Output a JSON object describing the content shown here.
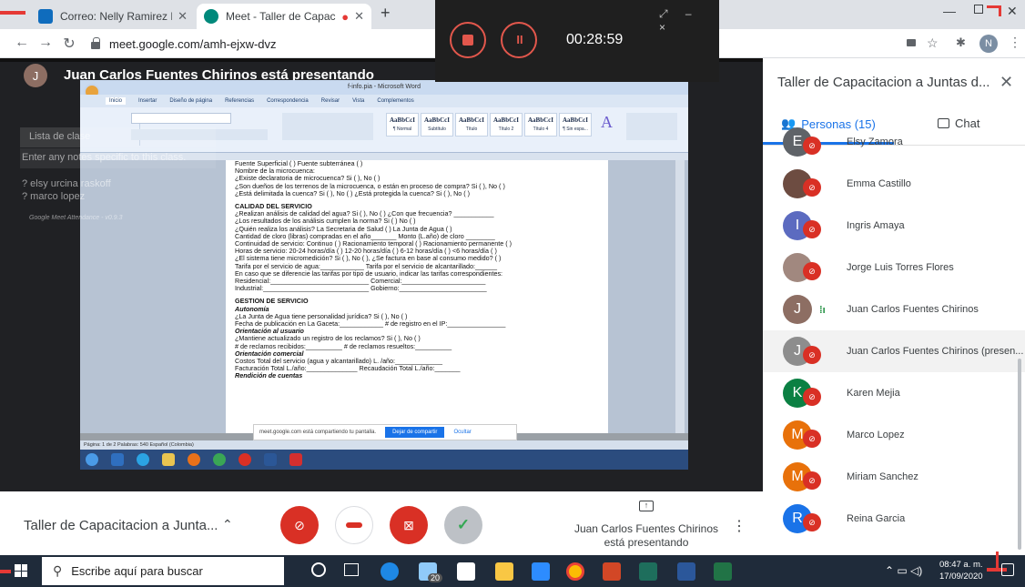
{
  "browser": {
    "tabs": [
      {
        "title": "Correo: Nelly Ramirez Lagos - Ou",
        "icon_color": "#0f6cbd"
      },
      {
        "title": "Meet - Taller de Capacitacion",
        "icon_color": "#00897b"
      }
    ],
    "new_tab": "+",
    "url": "meet.google.com/amh-ejxw-dvz",
    "profile_initial": "N"
  },
  "recorder": {
    "time": "00:28:59",
    "controls": "⤢ – ×"
  },
  "presenter": {
    "initial": "J",
    "title": "Juan Carlos Fuentes Chirinos está presentando"
  },
  "shared_screen": {
    "window_title": "f-info.pia - Microsoft Word",
    "ribbon_tabs": [
      "Inicio",
      "Insertar",
      "Diseño de página",
      "Referencias",
      "Correspondencia",
      "Revisar",
      "Vista",
      "Complementos"
    ],
    "styles": [
      {
        "sample": "AaBbCcI",
        "name": "¶ Normal"
      },
      {
        "sample": "AaBbCcI",
        "name": "Subtítulo"
      },
      {
        "sample": "AaBbCcI",
        "name": "Título"
      },
      {
        "sample": "AaBbCcI",
        "name": "Título 2"
      },
      {
        "sample": "AaBbCcI",
        "name": "Título 4"
      },
      {
        "sample": "AaBbCcI",
        "name": "¶ Sin espa..."
      }
    ],
    "doc_lines": [
      {
        "t": "Fuente Superficial (   )                           Fuente subterránea (   )",
        "k": "n"
      },
      {
        "t": "Nombre de la microcuenca:",
        "k": "n"
      },
      {
        "t": "¿Existe declaratoria de microcuenca? Si (   ), No (   )",
        "k": "n"
      },
      {
        "t": "¿Son dueños de los terrenos de la microcuenca, o están en proceso de compra? Si (   ), No (   )",
        "k": "n"
      },
      {
        "t": "¿Está delimitada la cuenca? Si (   ), No (   )      ¿Está protegida la cuenca? Si (   ), No (   )",
        "k": "n"
      },
      {
        "t": "CALIDAD DEL SERVICIO",
        "k": "h"
      },
      {
        "t": "¿Realizan análisis de calidad del agua? Si (   ), No (   ) ¿Con que frecuencia? ___________",
        "k": "n"
      },
      {
        "t": "¿Los resultados de los análisis cumplen la norma? Si (   ) No (   )",
        "k": "n"
      },
      {
        "t": "¿Quién realiza los análisis?  La Secretaria de Salud (   )  La Junta de Agua (   )",
        "k": "n"
      },
      {
        "t": "Cantidad de cloro (libras) compradas en el año_______          Monto (L.año) de cloro ________",
        "k": "n"
      },
      {
        "t": "Continuidad de servicio: Continuo (   ) Racionamiento temporal (   ) Racionamiento permanente (   )",
        "k": "n"
      },
      {
        "t": "Horas de servicio: 20-24 horas/día (   )  12-20 horas/día (   )  6-12 horas/día (   )  <6 horas/día (   )",
        "k": "n"
      },
      {
        "t": "¿El sistema tiene micromedición? Si (   ), No (   ), ¿Se factura en base al consumo medido? (   )",
        "k": "n"
      },
      {
        "t": "Tarifa por el servicio de agua:____________    Tarifa por el servicio de alcantarillado:______",
        "k": "n"
      },
      {
        "t": "En caso que se diferencie las tarifas por tipo de usuario, indicar las tarifas correspondientes:",
        "k": "n"
      },
      {
        "t": "Residencial:___________________________    Comercial:_______________________",
        "k": "n"
      },
      {
        "t": "Industrial:_____________________________    Gobierno:________________________",
        "k": "n"
      },
      {
        "t": "GESTION DE SERVICIO",
        "k": "h"
      },
      {
        "t": "Autonomía",
        "k": "s"
      },
      {
        "t": "¿La Junta de Agua tiene personalidad jurídica? Si (   ), No (   )",
        "k": "n"
      },
      {
        "t": "Fecha de publicación en La Gaceta:____________    # de registro en el IP:________________",
        "k": "n"
      },
      {
        "t": "Orientación al usuario",
        "k": "s"
      },
      {
        "t": "¿Mantiene actualizado un registro de los reclamos? Si (   ), No (   )",
        "k": "n"
      },
      {
        "t": "# de reclamos recibidos:__________    # de reclamos resueltos:__________",
        "k": "n"
      },
      {
        "t": "Orientación comercial",
        "k": "s"
      },
      {
        "t": "Costos Total del servicio (agua y alcantarillado) L. /año:_____________",
        "k": "n"
      },
      {
        "t": "Facturación Total L./año:______________    Recaudación Total L./año:_______",
        "k": "n"
      },
      {
        "t": "Rendición de cuentas",
        "k": "s"
      }
    ],
    "share_notice": "meet.google.com está compartiendo tu pantalla.",
    "share_stop": "Dejar de compartir",
    "share_hide": "Ocultar",
    "status": "Página: 1 de 2   Palabras: 540   Español (Colombia)"
  },
  "attendance": {
    "list_label": "Lista de clase",
    "input_placeholder": "Enter any notes specific to this class.",
    "entries": [
      "? elsy urcina raskoff",
      "? marco lopez"
    ],
    "footer": "Google Meet Attendance - v0.9.3"
  },
  "bottombar": {
    "meeting_title": "Taller de Capacitacion a Junta...",
    "present_line1": "Juan Carlos Fuentes Chirinos",
    "present_line2": "está presentando"
  },
  "panel": {
    "title": "Taller de Capacitacion a Juntas d...",
    "people_tab": "Personas (15)",
    "chat_tab": "Chat",
    "people": [
      {
        "name": "Elsy Zamora",
        "initial": "E",
        "color": "#5f6368",
        "muted": true
      },
      {
        "name": "Emma Castillo",
        "initial": "",
        "color": "#6d4c41",
        "muted": true
      },
      {
        "name": "Ingris Amaya",
        "initial": "I",
        "color": "#5c6bc0",
        "muted": true
      },
      {
        "name": "Jorge Luis Torres Flores",
        "initial": "",
        "color": "#a1887f",
        "muted": true
      },
      {
        "name": "Juan Carlos Fuentes Chirinos",
        "initial": "J",
        "color": "#8d6e63",
        "muted": false
      },
      {
        "name": "Juan Carlos Fuentes Chirinos (presen...",
        "initial": "J",
        "color": "#8d8d8d",
        "muted": true
      },
      {
        "name": "Karen Mejia",
        "initial": "K",
        "color": "#0b8043",
        "muted": true
      },
      {
        "name": "Marco Lopez",
        "initial": "M",
        "color": "#e8710a",
        "muted": true
      },
      {
        "name": "Miriam Sanchez",
        "initial": "M",
        "color": "#e8710a",
        "muted": true
      },
      {
        "name": "Reina Garcia",
        "initial": "R",
        "color": "#1a73e8",
        "muted": true
      }
    ]
  },
  "taskbar": {
    "search_placeholder": "Escribe aquí para buscar",
    "time": "08:47 a. m.",
    "date": "17/09/2020",
    "badge": "20"
  }
}
